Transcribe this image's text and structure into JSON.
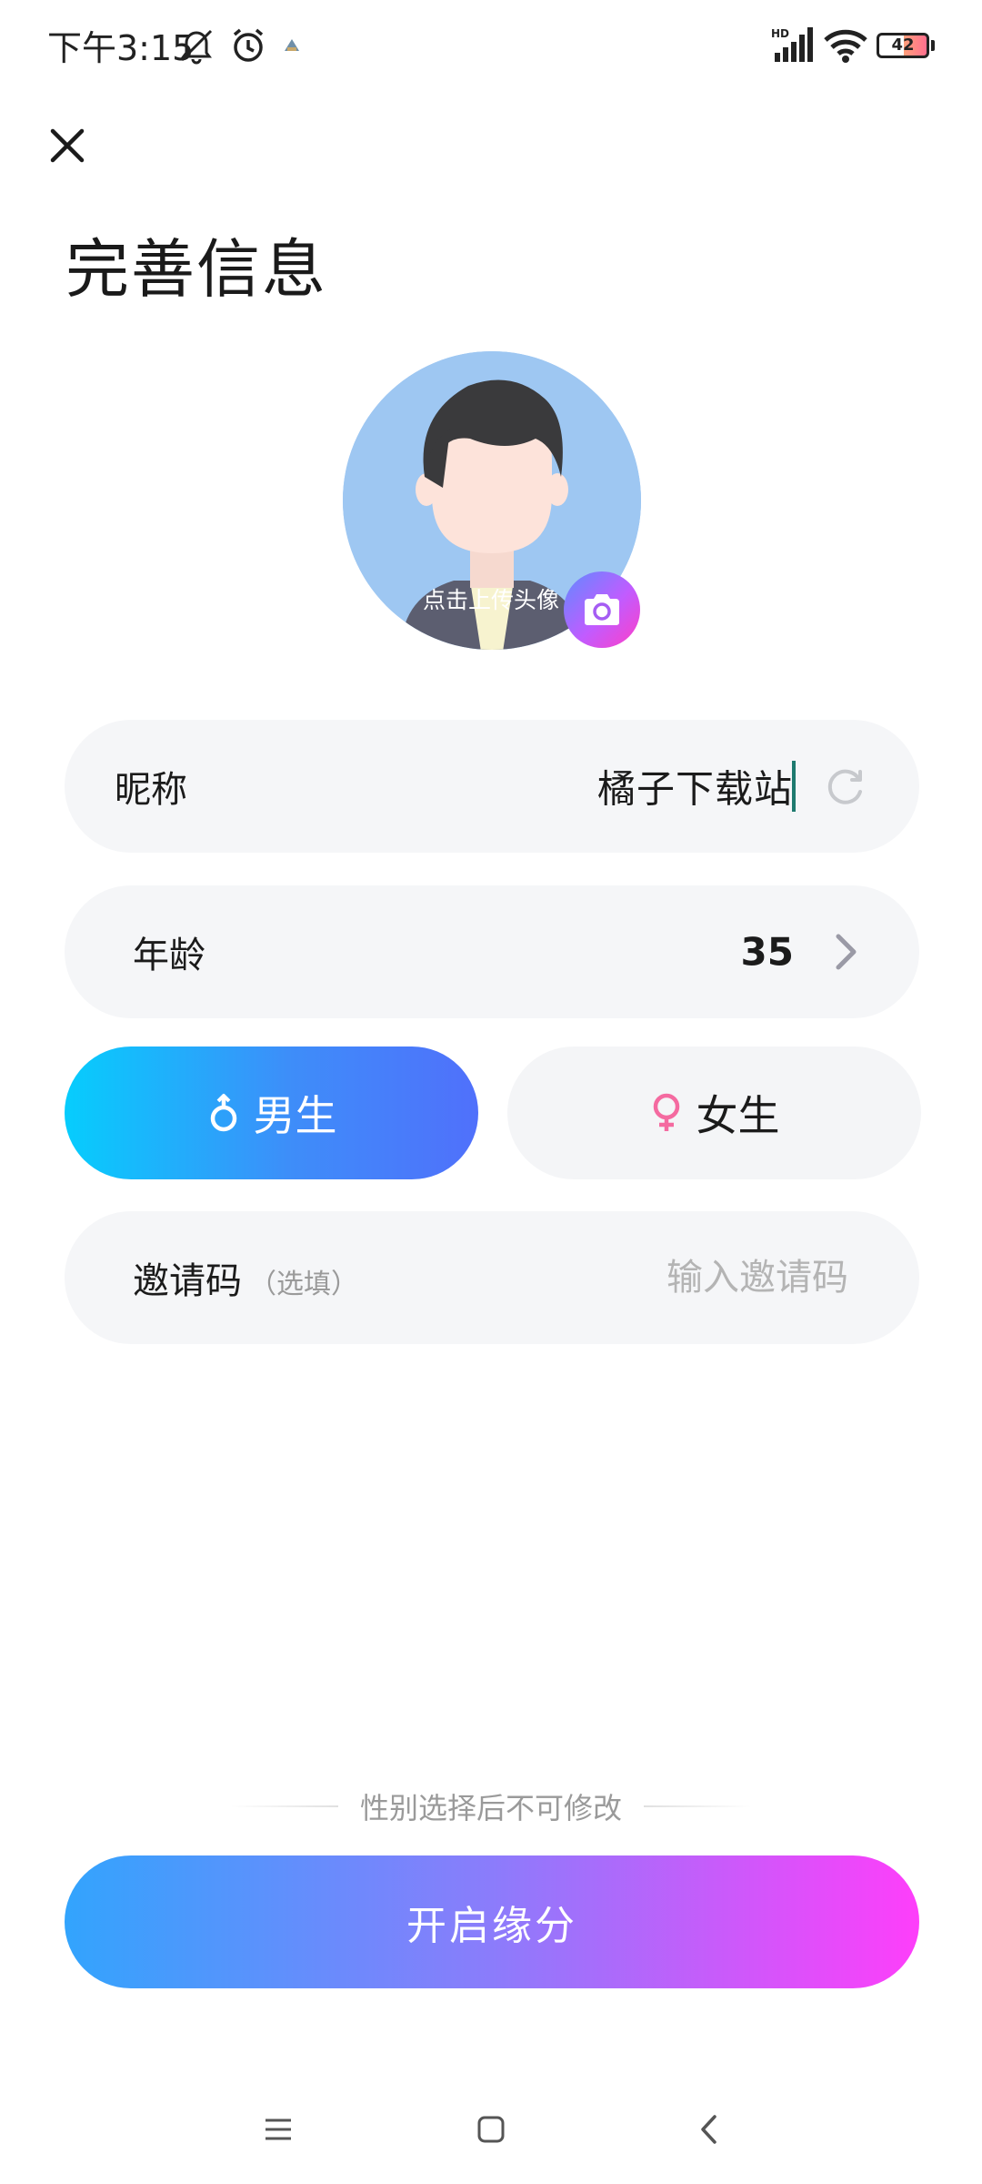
{
  "status_bar": {
    "time": "下午3:15",
    "battery_level": "42",
    "network_label": "HD",
    "icons": [
      "mute-icon",
      "alarm-icon",
      "app-notification-icon",
      "signal-icon",
      "wifi-icon",
      "battery-icon"
    ]
  },
  "header": {
    "title": "完善信息",
    "close_icon": "close-icon"
  },
  "avatar": {
    "caption": "点击上传头像",
    "camera_icon": "camera-icon"
  },
  "form": {
    "nickname": {
      "label": "昵称",
      "value": "橘子下载站",
      "icon": "refresh-icon"
    },
    "age": {
      "label": "年龄",
      "value": "35",
      "icon": "chevron-right-icon"
    },
    "gender": {
      "male_label": "男生",
      "female_label": "女生",
      "selected": "male",
      "male_color": "#06cdfd",
      "female_color": "#f46aa0"
    },
    "invite": {
      "label": "邀请码",
      "optional": "（选填）",
      "placeholder": "输入邀请码",
      "value": ""
    }
  },
  "notice": "性别选择后不可修改",
  "cta_label": "开启缘分",
  "nav": [
    "menu-icon",
    "home-icon",
    "back-icon"
  ]
}
